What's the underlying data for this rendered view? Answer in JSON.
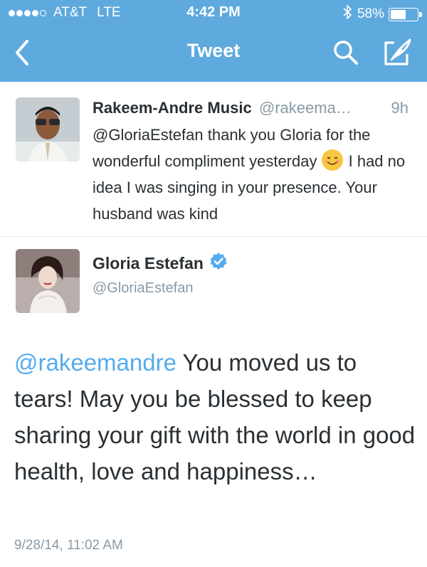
{
  "status_bar": {
    "carrier": "AT&T",
    "network": "LTE",
    "time": "4:42 PM",
    "battery_text": "58%",
    "battery_level": 0.58,
    "signal_bars_filled": 4,
    "signal_bars_total": 5
  },
  "nav": {
    "title": "Tweet",
    "back_icon": "chevron-left-icon",
    "search_icon": "search-icon",
    "compose_icon": "compose-icon"
  },
  "parent_tweet": {
    "name": "Rakeem-Andre Music",
    "handle": "@rakeema…",
    "time": "9h",
    "text_before_emoji": "@GloriaEstefan thank you Gloria for the wonderful compliment yesterday",
    "emoji": "smiling-face-emoji",
    "text_after_emoji": "I had no idea I was singing in your presence. Your husband was kind"
  },
  "main_tweet": {
    "name": "Gloria Estefan",
    "handle": "@GloriaEstefan",
    "verified": true,
    "mention": "@rakeemandre",
    "text": "You moved us to tears! May you be blessed to keep sharing your gift with the world in good health, love and happiness…",
    "timestamp": "9/28/14, 11:02 AM"
  },
  "colors": {
    "header_bg": "#5ea9dd",
    "link": "#55acee",
    "secondary_text": "#8899a6",
    "primary_text": "#292f33"
  }
}
